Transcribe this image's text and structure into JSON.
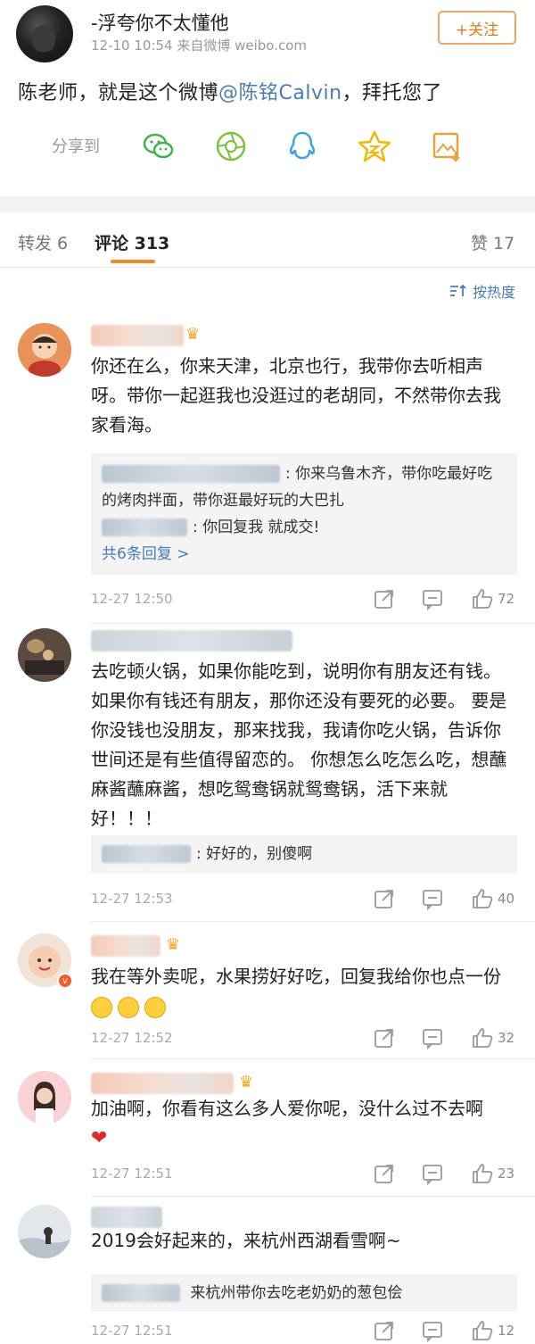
{
  "post": {
    "author": "-浮夸你不太懂他",
    "meta": "12-10 10:54  来自微博 weibo.com",
    "follow_label": "+关注",
    "text_before": "陈老师，就是这个微博",
    "mention": "@陈铭Calvin",
    "text_after": "，拜托您了",
    "share_label": "分享到",
    "share_icons": [
      "wechat-icon",
      "moments-icon",
      "qq-icon",
      "qzone-icon",
      "save-image-icon"
    ]
  },
  "tabs": {
    "repost": "转发 6",
    "comments": "评论 313",
    "likes": "赞 17",
    "sort": "按热度"
  },
  "comments": [
    {
      "text": "你还在么，你来天津，北京也行，我带你去听相声呀。带你一起逛我也没逛过的老胡同，不然带你去我家看海。",
      "replies": [
        {
          "text": ": 你来乌鲁木齐，带你吃最好吃的烤肉拌面，带你逛最好玩的大巴扎"
        },
        {
          "text": ": 你回复我 就成交!"
        }
      ],
      "more_replies": "共6条回复 >",
      "time": "12-27 12:50",
      "likes": "72"
    },
    {
      "text": "去吃顿火锅，如果你能吃到，说明你有朋友还有钱。如果你有钱还有朋友，那你还没有要死的必要。 要是你没钱也没朋友，那来找我，我请你吃火锅，告诉你世间还是有些值得留恋的。 你想怎么吃怎么吃，想蘸麻酱蘸麻酱，想吃鸳鸯锅就鸳鸯锅，活下来就好！！！",
      "replies": [
        {
          "text": ": 好好的，别傻啊"
        }
      ],
      "time": "12-27 12:53",
      "likes": "40"
    },
    {
      "text": "我在等外卖呢，水果捞好好吃，回复我给你也点一份",
      "time": "12-27 12:52",
      "likes": "32"
    },
    {
      "text": "加油啊，你看有这么多人爱你呢，没什么过不去啊",
      "time": "12-27 12:51",
      "likes": "23"
    },
    {
      "text": "2019会好起来的，来杭州西湖看雪啊~",
      "replies": [
        {
          "text": " 来杭州带你去吃老奶奶的葱包侩"
        }
      ],
      "time": "12-27 12:51",
      "likes": "12"
    }
  ],
  "colors": {
    "accent_orange": "#f08a24",
    "link_blue": "#4a7bb7"
  }
}
